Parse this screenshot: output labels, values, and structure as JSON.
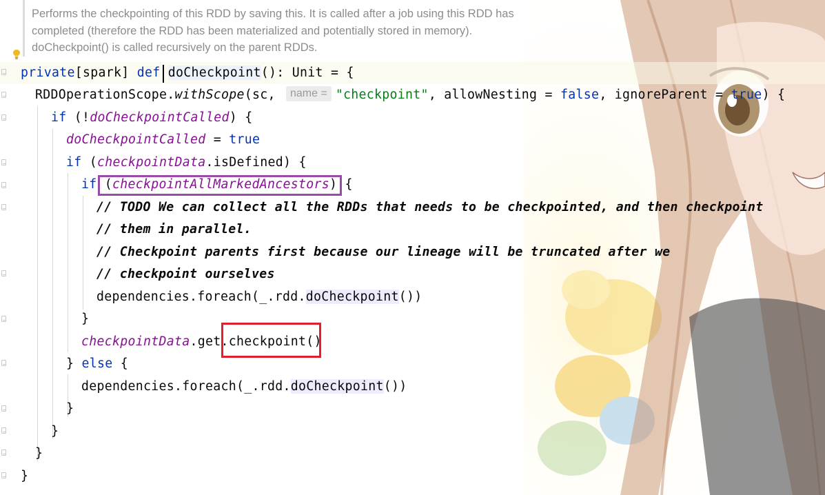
{
  "doc_comment": [
    "Performs the checkpointing of this RDD by saving this. It is called after a job using this RDD has",
    "completed (therefore the RDD has been materialized and potentially stored in memory).",
    "doCheckpoint() is called recursively on the parent RDDs."
  ],
  "code": {
    "l1_private": "private",
    "l1_scope": "[spark] ",
    "l1_def": "def ",
    "l1_name": "doCheckpoint",
    "l1_rest": "(): Unit = {",
    "l2_scope": "RDDOperationScope.",
    "l2_method": "withScope",
    "l2_args": "(sc, ",
    "l2_hint": "name =",
    "l2_string": "\"checkpoint\"",
    "l2_allow": ", allowNesting = ",
    "l2_false": "false",
    "l2_ignore": ", ignoreParent = ",
    "l2_true": "true",
    "l2_end": ") {",
    "l3_if": "if",
    "l3_open": " (!",
    "l3_field": "doCheckpointCalled",
    "l3_end": ") {",
    "l4_field": "doCheckpointCalled",
    "l4_eq": " = ",
    "l4_true": "true",
    "l5_if": "if",
    "l5_open": " (",
    "l5_field": "checkpointData",
    "l5_end": ".isDefined) {",
    "l6_if": "if",
    "l6_open": " (",
    "l6_field": "checkpointAllMarkedAncestors",
    "l6_end": ") {",
    "l7": "// TODO We can collect all the RDDs that needs to be checkpointed, and then checkpoint",
    "l8": "// them in parallel.",
    "l9": "// Checkpoint parents first because our lineage will be truncated after we",
    "l10": "// checkpoint ourselves",
    "l11_pre": "dependencies.foreach(_.rdd.",
    "l11_call": "doCheckpoint",
    "l11_end": "())",
    "l12": "}",
    "l13_field": "checkpointData",
    "l13_get": ".get.",
    "l13_call": "checkpoint()",
    "l14_close": "} ",
    "l14_else": "else",
    "l14_end": " {",
    "l15_pre": "dependencies.foreach(_.rdd.",
    "l15_call": "doCheckpoint",
    "l15_end": "())",
    "l16": "}",
    "l17": "}",
    "l18": "}",
    "l19": "}"
  },
  "colors": {
    "keyword": "#0033b3",
    "field": "#871094",
    "string": "#067d17",
    "annotation_purple": "#9a4ba8",
    "annotation_red": "#e0202e"
  }
}
